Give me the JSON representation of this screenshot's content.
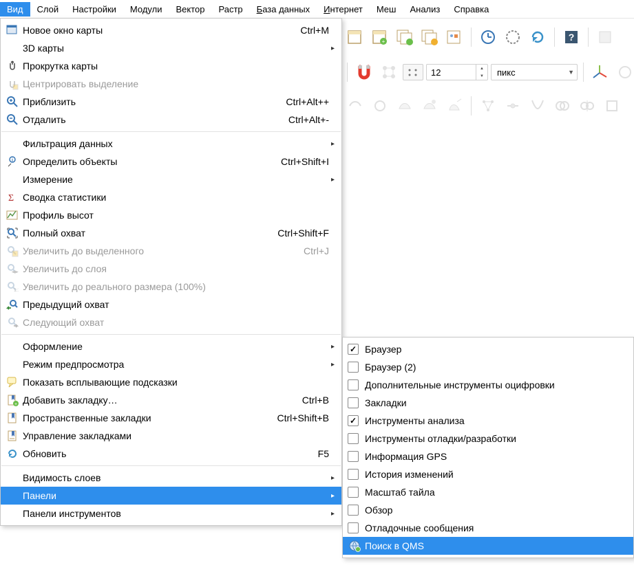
{
  "menubar": {
    "items": [
      {
        "label": "Вид",
        "active": true
      },
      {
        "label": "Слой"
      },
      {
        "label": "Настройки"
      },
      {
        "label": "Модули"
      },
      {
        "label": "Вектор"
      },
      {
        "label": "Растр"
      },
      {
        "label": "База данных",
        "underline": 0
      },
      {
        "label": "Интернет",
        "underline": 0
      },
      {
        "label": "Меш"
      },
      {
        "label": "Анализ"
      },
      {
        "label": "Справка"
      }
    ]
  },
  "icons": {
    "small_arrow": "▸",
    "sub_arrow": "▶"
  },
  "toolbar": {
    "spinner_value": "12",
    "combo_value": "пикс"
  },
  "viewMenu": [
    {
      "type": "item",
      "icon": "new-map-window-icon",
      "label": "Новое окно карты",
      "shortcut": "Ctrl+M"
    },
    {
      "type": "item",
      "label": "3D карты",
      "submenu": true
    },
    {
      "type": "item",
      "icon": "pan-icon",
      "label": "Прокрутка карты"
    },
    {
      "type": "item",
      "icon": "pan-to-selection-icon",
      "label": "Центрировать выделение",
      "disabled": true
    },
    {
      "type": "item",
      "icon": "zoom-in-icon",
      "label": "Приблизить",
      "shortcut": "Ctrl+Alt++"
    },
    {
      "type": "item",
      "icon": "zoom-out-icon",
      "label": "Отдалить",
      "shortcut": "Ctrl+Alt+-"
    },
    {
      "type": "sep"
    },
    {
      "type": "item",
      "label": "Фильтрация данных",
      "submenu": true
    },
    {
      "type": "item",
      "icon": "identify-icon",
      "label": "Определить объекты",
      "shortcut": "Ctrl+Shift+I"
    },
    {
      "type": "item",
      "label": "Измерение",
      "submenu": true
    },
    {
      "type": "item",
      "icon": "sigma-icon",
      "label": "Сводка статистики"
    },
    {
      "type": "item",
      "icon": "elevation-profile-icon",
      "label": "Профиль высот"
    },
    {
      "type": "item",
      "icon": "zoom-full-icon",
      "label": "Полный охват",
      "shortcut": "Ctrl+Shift+F"
    },
    {
      "type": "item",
      "icon": "zoom-to-selection-icon",
      "label": "Увеличить до выделенного",
      "shortcut": "Ctrl+J",
      "disabled": true
    },
    {
      "type": "item",
      "icon": "zoom-to-layer-icon",
      "label": "Увеличить до слоя",
      "disabled": true
    },
    {
      "type": "item",
      "icon": "zoom-actual-icon",
      "label": "Увеличить до реального размера (100%)",
      "disabled": true
    },
    {
      "type": "item",
      "icon": "zoom-last-icon",
      "label": "Предыдущий охват"
    },
    {
      "type": "item",
      "icon": "zoom-next-icon",
      "label": "Следующий охват",
      "disabled": true
    },
    {
      "type": "sep"
    },
    {
      "type": "item",
      "label": "Оформление",
      "submenu": true
    },
    {
      "type": "item",
      "label": "Режим предпросмотра",
      "submenu": true
    },
    {
      "type": "item",
      "icon": "maptips-icon",
      "label": "Показать всплывающие подсказки"
    },
    {
      "type": "item",
      "icon": "new-bookmark-icon",
      "label": "Добавить закладку…",
      "shortcut": "Ctrl+B"
    },
    {
      "type": "item",
      "icon": "show-bookmarks-icon",
      "label": "Пространственные закладки",
      "shortcut": "Ctrl+Shift+B"
    },
    {
      "type": "item",
      "icon": "bookmark-manager-icon",
      "label": "Управление закладками"
    },
    {
      "type": "item",
      "icon": "refresh-icon",
      "label": "Обновить",
      "shortcut": "F5"
    },
    {
      "type": "sep"
    },
    {
      "type": "item",
      "label": "Видимость слоев",
      "submenu": true
    },
    {
      "type": "item",
      "label": "Панели",
      "submenu": true,
      "highlight": true
    },
    {
      "type": "item",
      "label": "Панели инструментов",
      "submenu": true
    }
  ],
  "panelsSubmenu": [
    {
      "label": "Браузер",
      "checked": true
    },
    {
      "label": "Браузер (2)"
    },
    {
      "label": "Дополнительные инструменты оцифровки"
    },
    {
      "label": "Закладки"
    },
    {
      "label": "Инструменты анализа",
      "checked": true
    },
    {
      "label": "Инструменты отладки/разработки"
    },
    {
      "label": "Информация GPS"
    },
    {
      "label": "История изменений"
    },
    {
      "label": "Масштаб тайла"
    },
    {
      "label": "Обзор"
    },
    {
      "label": "Отладочные сообщения"
    },
    {
      "label": "Поиск в QMS",
      "icon": "qms-search-icon",
      "highlight": true
    }
  ]
}
